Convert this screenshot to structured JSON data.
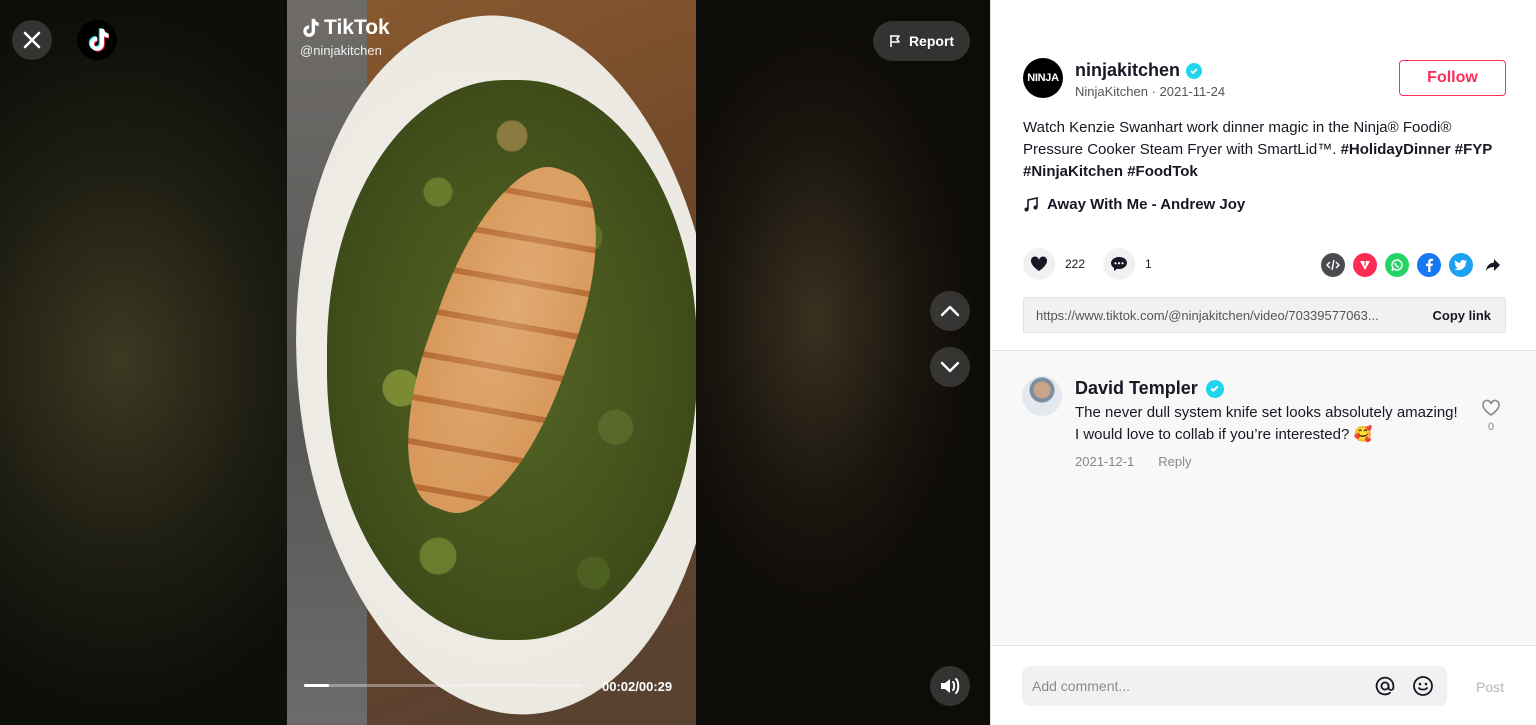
{
  "player": {
    "watermark_brand": "TikTok",
    "watermark_handle": "@ninjakitchen",
    "report_label": "Report",
    "time": "00:02/00:29",
    "progress": 0.09
  },
  "author": {
    "avatar_text": "NINJA",
    "handle": "ninjakitchen",
    "meta": "NinjaKitchen · 2021-11-24",
    "follow_label": "Follow"
  },
  "caption": {
    "text": "Watch Kenzie Swanhart work dinner magic in the Ninja® Foodi® Pressure Cooker Steam Fryer with SmartLid™. ",
    "hashtags": [
      "#HolidayDinner",
      "#FYP",
      "#NinjaKitchen",
      "#FoodTok"
    ]
  },
  "music": "Away With Me - Andrew Joy",
  "stats": {
    "likes": "222",
    "comments": "1"
  },
  "share_icons": [
    "embed-icon",
    "send-icon",
    "whatsapp-icon",
    "facebook-icon",
    "twitter-icon",
    "share-arrow-icon"
  ],
  "link": {
    "url": "https://www.tiktok.com/@ninjakitchen/video/70339577063...",
    "copy_label": "Copy link"
  },
  "comment": {
    "author": "David Templer",
    "text": "The never dull system knife set looks absolutely amazing! I would love to collab if you’re interested? 🥰",
    "date": "2021-12-1",
    "reply_label": "Reply",
    "likes": "0"
  },
  "comment_box": {
    "placeholder": "Add comment...",
    "post_label": "Post"
  },
  "colors": {
    "accent": "#fe2c55",
    "verified": "#20d5ec"
  }
}
